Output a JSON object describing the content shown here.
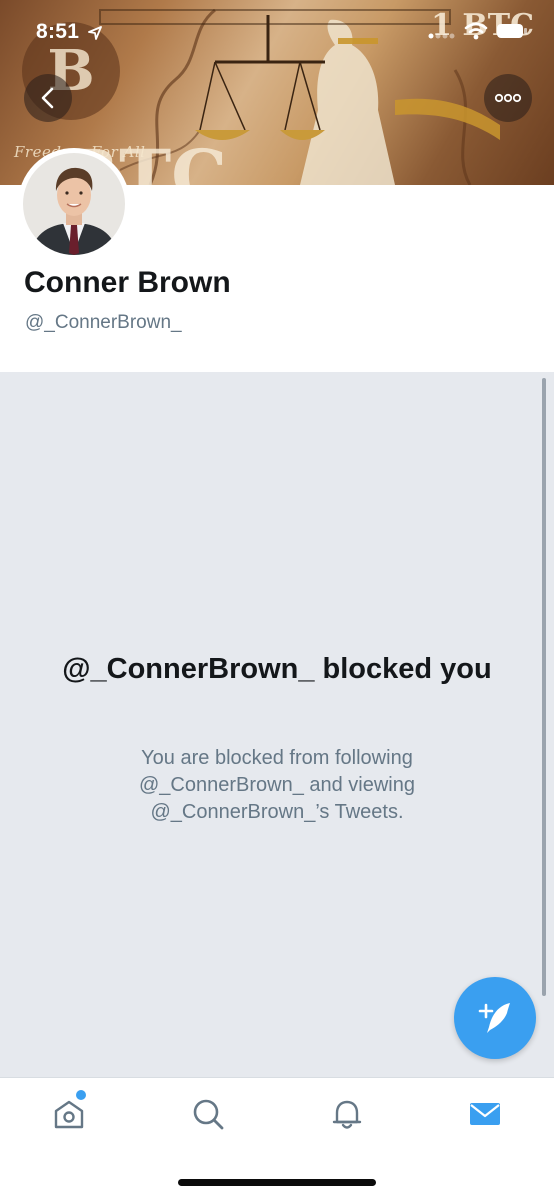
{
  "status_bar": {
    "time": "8:51"
  },
  "banner": {
    "motto": "Freedom For All",
    "mark": "1 BTC",
    "big_letter": "B"
  },
  "profile": {
    "name": "Conner Brown",
    "handle": "@_ConnerBrown_"
  },
  "blocked": {
    "title": "@_ConnerBrown_ blocked you",
    "body": "You are blocked from following @_ConnerBrown_ and viewing @_ConnerBrown_’s Tweets."
  },
  "colors": {
    "accent": "#3a9ff0",
    "background_gray": "#e6e9ee",
    "text_primary": "#14171a",
    "text_secondary": "#657786"
  },
  "icons": {
    "back": "chevron-left-icon",
    "more": "more-dots-icon",
    "compose": "compose-tweet-icon",
    "home": "home-icon",
    "search": "search-icon",
    "notifications": "bell-icon",
    "messages": "mail-icon"
  },
  "tab_bar": {
    "active_tab": "messages",
    "home_unread": true
  }
}
